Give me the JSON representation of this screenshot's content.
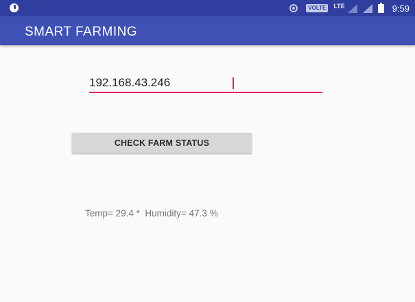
{
  "status_bar": {
    "volte_badge": "VOLTE",
    "network_type": "LTE",
    "time": "9:59"
  },
  "app_bar": {
    "title": "SMART FARMING"
  },
  "ip_input": {
    "value": "192.168.43.246"
  },
  "check_button": {
    "label": "CHECK FARM STATUS"
  },
  "farm_status": {
    "text": "Temp= 29.4 *  Humidity= 47.3 %"
  },
  "colors": {
    "status_bar": "#303f9f",
    "app_bar": "#3f51b5",
    "accent": "#e91e63",
    "button": "#d6d7d7",
    "background": "#fafafa"
  },
  "icons": {
    "status_left": "notification-icon",
    "hotspot": "hotspot-icon",
    "signal_1": "signal-icon",
    "signal_2": "signal-icon",
    "battery": "battery-icon"
  }
}
